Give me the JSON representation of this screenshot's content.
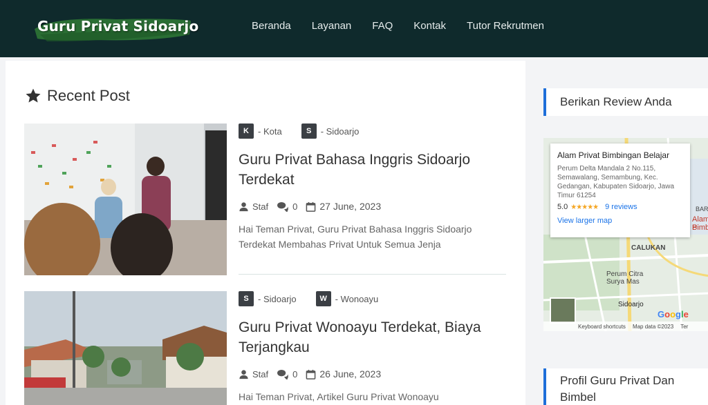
{
  "header": {
    "logo": "Guru Privat Sidoarjo",
    "nav": [
      "Beranda",
      "Layanan",
      "FAQ",
      "Kontak",
      "Tutor Rekrutmen"
    ]
  },
  "main": {
    "section_title": "Recent Post",
    "posts": [
      {
        "cats": [
          {
            "badge": "K",
            "label": "- Kota"
          },
          {
            "badge": "S",
            "label": "- Sidoarjo"
          }
        ],
        "title": "Guru Privat Bahasa Inggris Sidoarjo Terdekat",
        "author": "Staf",
        "comments": "0",
        "date": "27 June, 2023",
        "excerpt": "Hai Teman Privat, Guru Privat Bahasa Inggris Sidoarjo Terdekat Membahas Privat Untuk Semua Jenja"
      },
      {
        "cats": [
          {
            "badge": "S",
            "label": "- Sidoarjo"
          },
          {
            "badge": "W",
            "label": "- Wonoayu"
          }
        ],
        "title": "Guru Privat Wonoayu Terdekat, Biaya Terjangkau",
        "author": "Staf",
        "comments": "0",
        "date": "26 June, 2023",
        "excerpt": "Hai Teman Privat, Artikel Guru Privat Wonoayu"
      }
    ]
  },
  "sidebar": {
    "review_heading": "Berikan Review Anda",
    "map": {
      "place_name": "Alam Privat Bimbingan Belajar",
      "address": "Perum Delta Mandala 2 No.115, Semawalang, Semambung, Kec. Gedangan, Kabupaten Sidoarjo, Jawa Timur 61254",
      "rating": "5.0",
      "stars": "★★★★★",
      "reviews": "9 reviews",
      "larger_map": "View larger map",
      "labels": {
        "calukan": "CALUKAN",
        "citra": "Perum Citra",
        "surya": "Surya Mas",
        "sidoarjo": "Sidoarjo",
        "alam": "Alam P",
        "bimbin": "Bimbin",
        "bar": "BAR"
      },
      "google": "Google",
      "footer": [
        "Keyboard shortcuts",
        "Map data ©2023",
        "Ter"
      ]
    },
    "profile_heading": "Profil Guru Privat Dan Bimbel"
  },
  "colors": {
    "header_bg": "#0f2a2c",
    "accent": "#1e6fd9",
    "badge_bg": "#3b3f44"
  }
}
